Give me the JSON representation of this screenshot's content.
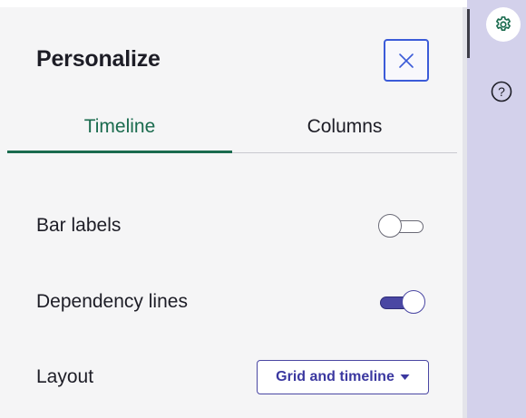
{
  "panel": {
    "title": "Personalize",
    "close_label": "×"
  },
  "tabs": [
    {
      "label": "Timeline",
      "active": true
    },
    {
      "label": "Columns",
      "active": false
    }
  ],
  "settings": {
    "bar_labels": {
      "label": "Bar labels",
      "enabled": false
    },
    "dependency_lines": {
      "label": "Dependency lines",
      "enabled": true
    },
    "layout": {
      "label": "Layout",
      "value": "Grid and timeline"
    }
  },
  "rail": {
    "settings_icon": "gear-icon",
    "help_icon": "question-circle-icon",
    "help_glyph": "?"
  },
  "colors": {
    "accent_green": "#1a6b4e",
    "accent_purple": "#4a47a3",
    "close_border": "#3b5bd8",
    "rail_bg": "#d3d1eb"
  }
}
